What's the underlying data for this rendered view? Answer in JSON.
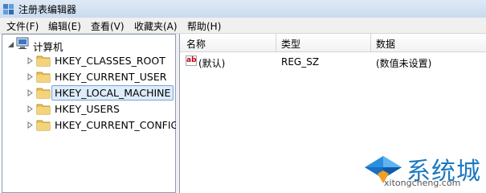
{
  "window": {
    "title": "注册表编辑器"
  },
  "menu": [
    "文件(F)",
    "编辑(E)",
    "查看(V)",
    "收藏夹(A)",
    "帮助(H)"
  ],
  "tree": {
    "root": "计算机",
    "keys": [
      "HKEY_CLASSES_ROOT",
      "HKEY_CURRENT_USER",
      "HKEY_LOCAL_MACHINE",
      "HKEY_USERS",
      "HKEY_CURRENT_CONFIG"
    ],
    "selected": "HKEY_LOCAL_MACHINE"
  },
  "list": {
    "columns": [
      "名称",
      "类型",
      "数据"
    ],
    "rows": [
      {
        "name": "(默认)",
        "type": "REG_SZ",
        "data": "(数值未设置)"
      }
    ],
    "icon_text": "ab"
  },
  "watermark": {
    "brand": "系统城",
    "url": "xitongcheng.com"
  },
  "colors": {
    "folder": "#e8c35a",
    "watermark_blue": "#1c79c0",
    "selection": "#ddecfb"
  }
}
